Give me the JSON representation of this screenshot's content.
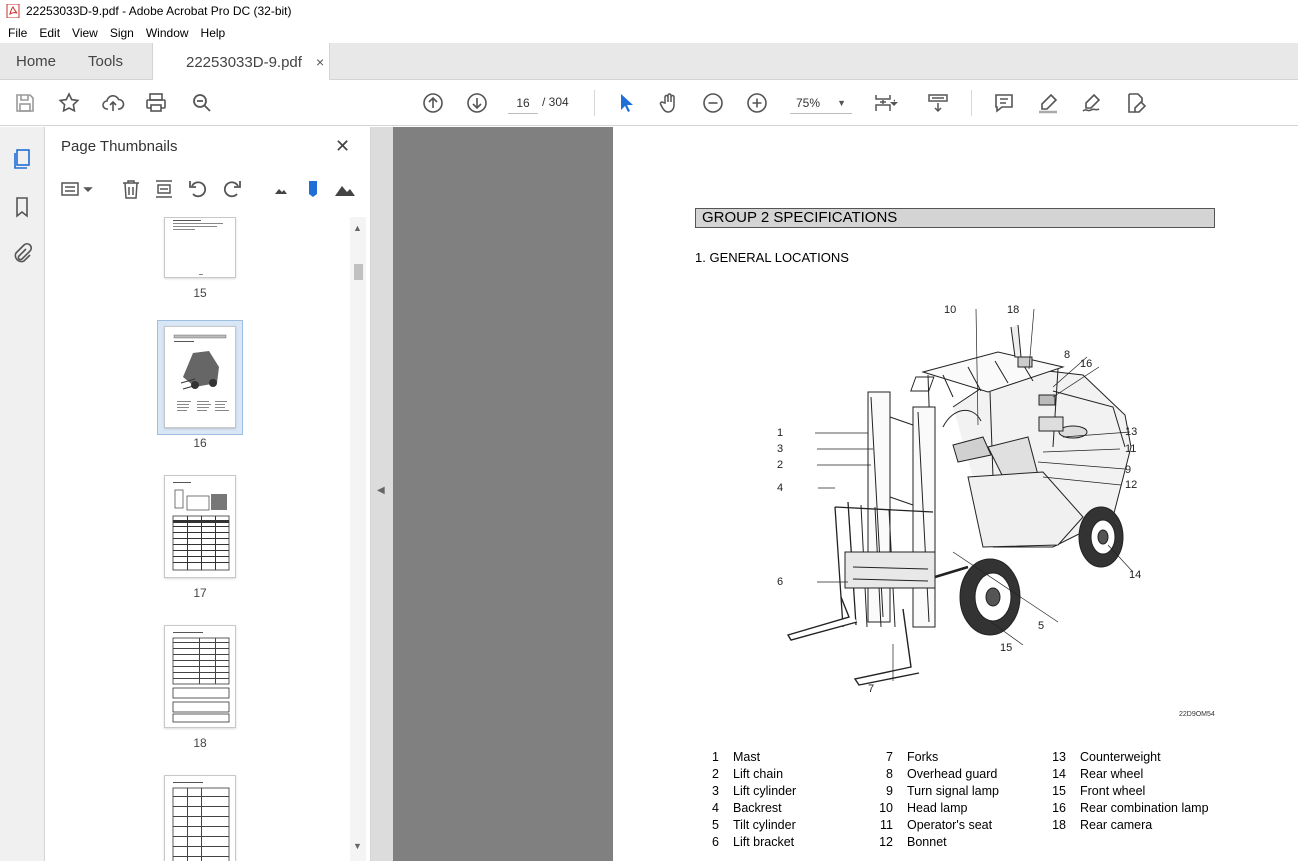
{
  "window": {
    "title": "22253033D-9.pdf - Adobe Acrobat Pro DC (32-bit)"
  },
  "menu": [
    "File",
    "Edit",
    "View",
    "Sign",
    "Window",
    "Help"
  ],
  "tabs": {
    "home": "Home",
    "tools": "Tools",
    "document": "22253033D-9.pdf",
    "close": "×"
  },
  "toolbar": {
    "page_current": "16",
    "page_total": "/ 304",
    "zoom": "75%"
  },
  "panel": {
    "title": "Page Thumbnails",
    "close": "✕",
    "thumbnails": [
      {
        "number": "15"
      },
      {
        "number": "16",
        "selected": true
      },
      {
        "number": "17"
      },
      {
        "number": "18"
      }
    ]
  },
  "document": {
    "group_heading": "GROUP 2  SPECIFICATIONS",
    "section_heading": "1. GENERAL LOCATIONS",
    "figure_code": "22D9OM54",
    "callouts": [
      "10",
      "18",
      "8",
      "16",
      "13",
      "11",
      "9",
      "12",
      "1",
      "3",
      "2",
      "4",
      "6",
      "7",
      "14",
      "5",
      "15"
    ],
    "legend": {
      "col1": [
        {
          "num": "1",
          "label": "Mast"
        },
        {
          "num": "2",
          "label": "Lift chain"
        },
        {
          "num": "3",
          "label": "Lift cylinder"
        },
        {
          "num": "4",
          "label": "Backrest"
        },
        {
          "num": "5",
          "label": "Tilt cylinder"
        },
        {
          "num": "6",
          "label": "Lift bracket"
        }
      ],
      "col2": [
        {
          "num": "7",
          "label": "Forks"
        },
        {
          "num": "8",
          "label": "Overhead guard"
        },
        {
          "num": "9",
          "label": "Turn signal lamp"
        },
        {
          "num": "10",
          "label": "Head lamp"
        },
        {
          "num": "11",
          "label": "Operator's seat"
        },
        {
          "num": "12",
          "label": "Bonnet"
        }
      ],
      "col3": [
        {
          "num": "13",
          "label": "Counterweight"
        },
        {
          "num": "14",
          "label": "Rear wheel"
        },
        {
          "num": "15",
          "label": "Front wheel"
        },
        {
          "num": "16",
          "label": "Rear combination lamp"
        },
        {
          "num": "18",
          "label": "Rear camera"
        }
      ]
    }
  }
}
